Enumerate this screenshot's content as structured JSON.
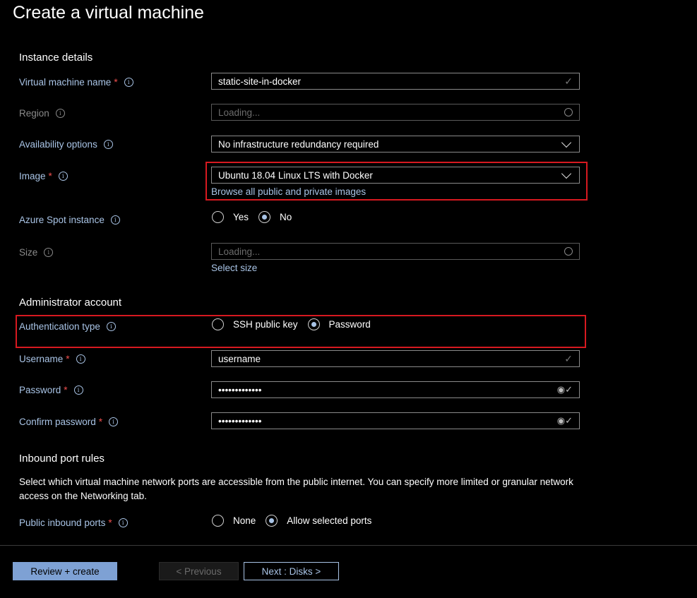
{
  "page_title": "Create a virtual machine",
  "sections": {
    "instance_details": "Instance details",
    "administrator_account": "Administrator account",
    "inbound_port_rules": "Inbound port rules"
  },
  "fields": {
    "vm_name": {
      "label": "Virtual machine name",
      "required": "*",
      "value": "static-site-in-docker"
    },
    "region": {
      "label": "Region",
      "value": "Loading..."
    },
    "availability": {
      "label": "Availability options",
      "value": "No infrastructure redundancy required"
    },
    "image": {
      "label": "Image",
      "required": "*",
      "value": "Ubuntu 18.04 Linux LTS with Docker",
      "link": "Browse all public and private images"
    },
    "spot": {
      "label": "Azure Spot instance",
      "options": [
        "Yes",
        "No"
      ],
      "selected": "No"
    },
    "size": {
      "label": "Size",
      "value": "Loading...",
      "link": "Select size"
    },
    "auth_type": {
      "label": "Authentication type",
      "options": [
        "SSH public key",
        "Password"
      ],
      "selected": "Password"
    },
    "username": {
      "label": "Username",
      "required": "*",
      "value": "username"
    },
    "password": {
      "label": "Password",
      "required": "*",
      "value": "•••••••••••••"
    },
    "confirm_password": {
      "label": "Confirm password",
      "required": "*",
      "value": "•••••••••••••"
    },
    "public_ports": {
      "label": "Public inbound ports",
      "required": "*",
      "options": [
        "None",
        "Allow selected ports"
      ],
      "selected": "Allow selected ports"
    }
  },
  "inbound_description": "Select which virtual machine network ports are accessible from the public internet. You can specify more limited or granular network access on the Networking tab.",
  "buttons": {
    "review_create": "Review + create",
    "previous": "< Previous",
    "next": "Next : Disks >"
  },
  "colors": {
    "background": "#000000",
    "label_blue": "#a9c4e6",
    "required_red": "#f0504f",
    "highlight_box": "#d71920",
    "primary_button": "#7ea1d4"
  }
}
